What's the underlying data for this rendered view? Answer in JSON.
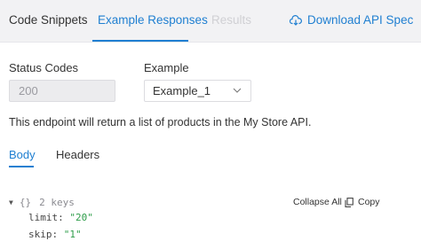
{
  "tabs": {
    "code_snippets": "Code Snippets",
    "example_responses": "Example Responses",
    "results": "Results",
    "download": "Download API Spec"
  },
  "form": {
    "status_label": "Status Codes",
    "status_value": "200",
    "example_label": "Example",
    "example_value": "Example_1"
  },
  "description": "This endpoint will return a list of products in the My Store API.",
  "subtabs": {
    "body": "Body",
    "headers": "Headers"
  },
  "json_view": {
    "braces": "{}",
    "key_count": "2 keys",
    "collapse_label": "Collapse All",
    "copy_label": "Copy",
    "entries": [
      {
        "key": "limit:",
        "value": "\"20\""
      },
      {
        "key": "skip:",
        "value": "\"1\""
      }
    ]
  },
  "colors": {
    "accent": "#1f7fd1",
    "string_value": "#2e9d4a"
  }
}
